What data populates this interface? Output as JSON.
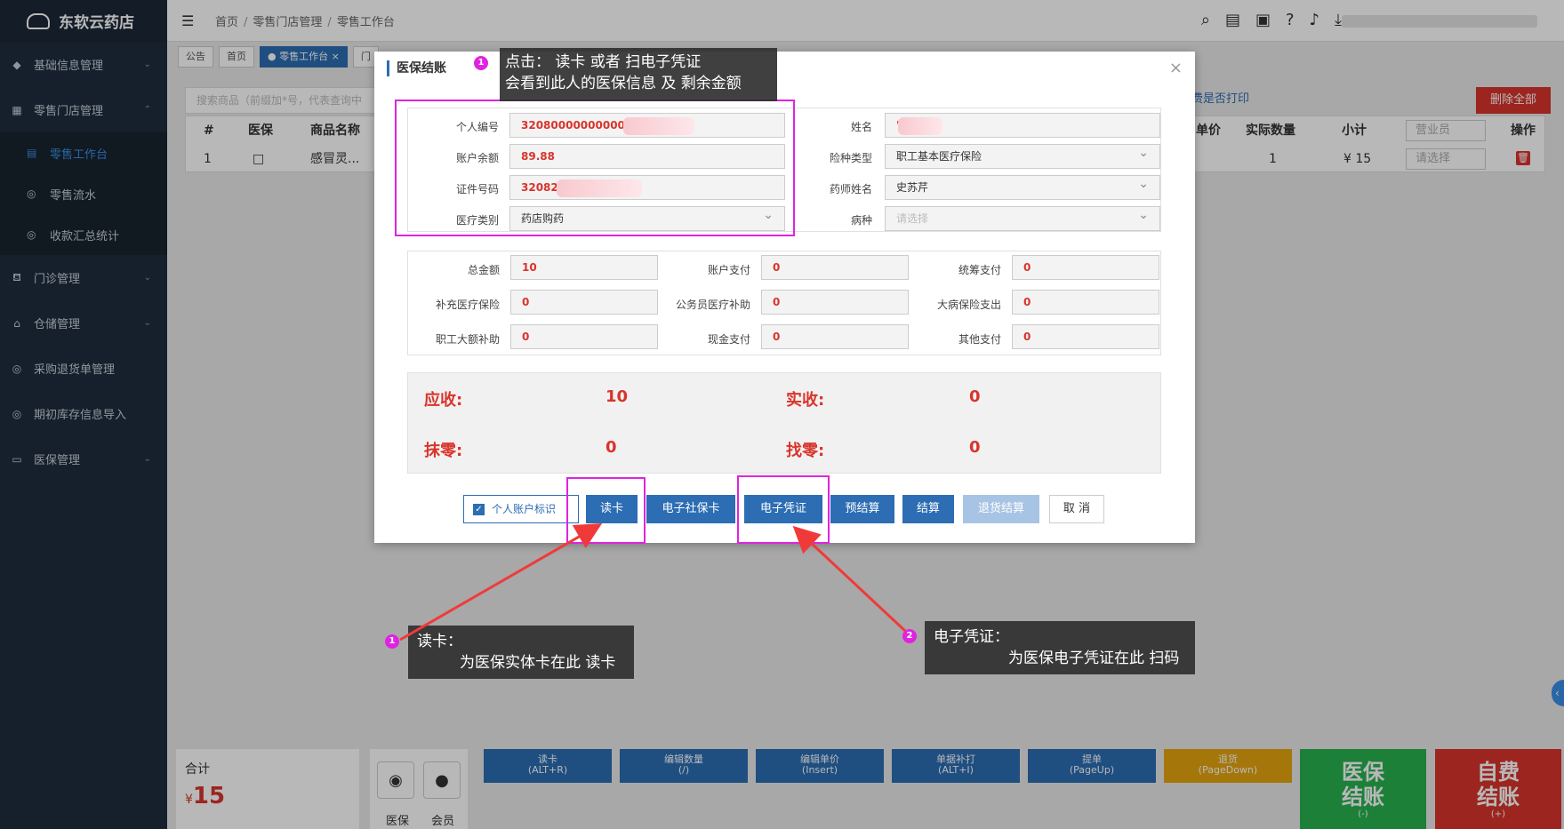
{
  "brand": "东软云药店",
  "sidebar": {
    "items": [
      {
        "label": "基础信息管理"
      },
      {
        "label": "零售门店管理"
      },
      {
        "label": "门诊管理"
      },
      {
        "label": "仓储管理"
      },
      {
        "label": "采购退货单管理"
      },
      {
        "label": "期初库存信息导入"
      },
      {
        "label": "医保管理"
      }
    ],
    "subitems": [
      {
        "label": "零售工作台"
      },
      {
        "label": "零售流水"
      },
      {
        "label": "收款汇总统计"
      }
    ]
  },
  "breadcrumb": [
    "首页",
    "零售门店管理",
    "零售工作台"
  ],
  "tabs": [
    "公告",
    "首页",
    "● 零售工作台 ×",
    "门"
  ],
  "background": {
    "search_placeholder": "搜索商品（前缀加*号，代表查询中",
    "print_question": "费是否打印",
    "delete_all": "删除全部",
    "columns": [
      "#",
      "医保",
      "商品名称",
      "单价",
      "实际数量",
      "小计",
      "营业员",
      "操作"
    ],
    "row": {
      "index": "1",
      "name": "感冒灵...",
      "qty": "1",
      "subtotal": "¥ 15",
      "select": "请选择"
    }
  },
  "bottom": {
    "total_label": "合计",
    "total_currency": "¥",
    "total_value": "15",
    "member_labels": [
      "医保",
      "会员"
    ],
    "buttons": [
      {
        "label": "读卡",
        "key": "(ALT+R)"
      },
      {
        "label": "编辑数量",
        "key": "(/)"
      },
      {
        "label": "编辑单价",
        "key": "(Insert)"
      },
      {
        "label": "单据补打",
        "key": "(ALT+I)"
      },
      {
        "label": "提单",
        "key": "(PageUp)"
      },
      {
        "label": "退货",
        "key": "(PageDown)"
      }
    ],
    "big_green": {
      "label1": "医保",
      "label2": "结账",
      "key": "(-)"
    },
    "big_red": {
      "label1": "自费",
      "label2": "结账",
      "key": "(+)"
    }
  },
  "modal": {
    "title": "医保结账",
    "close": "×",
    "fields": {
      "personal_id_label": "个人编号",
      "personal_id_value": "32080000000000",
      "name_label": "姓名",
      "name_value": "'",
      "balance_label": "账户余额",
      "balance_value": "89.88",
      "insurance_type_label": "险种类型",
      "insurance_type_value": "职工基本医疗保险",
      "cert_label": "证件号码",
      "cert_value": "32082",
      "pharmacist_label": "药师姓名",
      "pharmacist_value": "史苏芹",
      "med_category_label": "医疗类别",
      "med_category_value": "药店购药",
      "disease_label": "病种",
      "disease_placeholder": "请选择"
    },
    "payments": [
      {
        "label": "总金额",
        "value": "10"
      },
      {
        "label": "账户支付",
        "value": "0"
      },
      {
        "label": "统筹支付",
        "value": "0"
      },
      {
        "label": "补充医疗保险",
        "value": "0"
      },
      {
        "label": "公务员医疗补助",
        "value": "0"
      },
      {
        "label": "大病保险支出",
        "value": "0"
      },
      {
        "label": "职工大额补助",
        "value": "0"
      },
      {
        "label": "现金支付",
        "value": "0"
      },
      {
        "label": "其他支付",
        "value": "0"
      }
    ],
    "summary": {
      "receivable_label": "应收:",
      "receivable_value": "10",
      "received_label": "实收:",
      "received_value": "0",
      "rounding_label": "抹零:",
      "rounding_value": "0",
      "change_label": "找零:",
      "change_value": "0"
    },
    "checkbox_label": "个人账户标识",
    "buttons": {
      "read_card": "读卡",
      "social_card": "电子社保卡",
      "e_voucher": "电子凭证",
      "pre_settle": "预结算",
      "settle": "结算",
      "refund_settle": "退货结算",
      "cancel": "取 消"
    }
  },
  "annotations": {
    "top_badge": "1",
    "top_line1": "点击： 读卡 或者 扫电子凭证",
    "top_line2": "会看到此人的医保信息 及 剩余金额",
    "left_badge": "1",
    "left_line1": "读卡：",
    "left_line2": "为医保实体卡在此  读卡",
    "right_badge": "2",
    "right_line1": "电子凭证：",
    "right_line2": "为医保电子凭证在此  扫码"
  },
  "colors": {
    "primary": "#2c6db3",
    "danger": "#d9342b",
    "annotation": "#e023e0",
    "sidebar": "#1f2d3d"
  }
}
